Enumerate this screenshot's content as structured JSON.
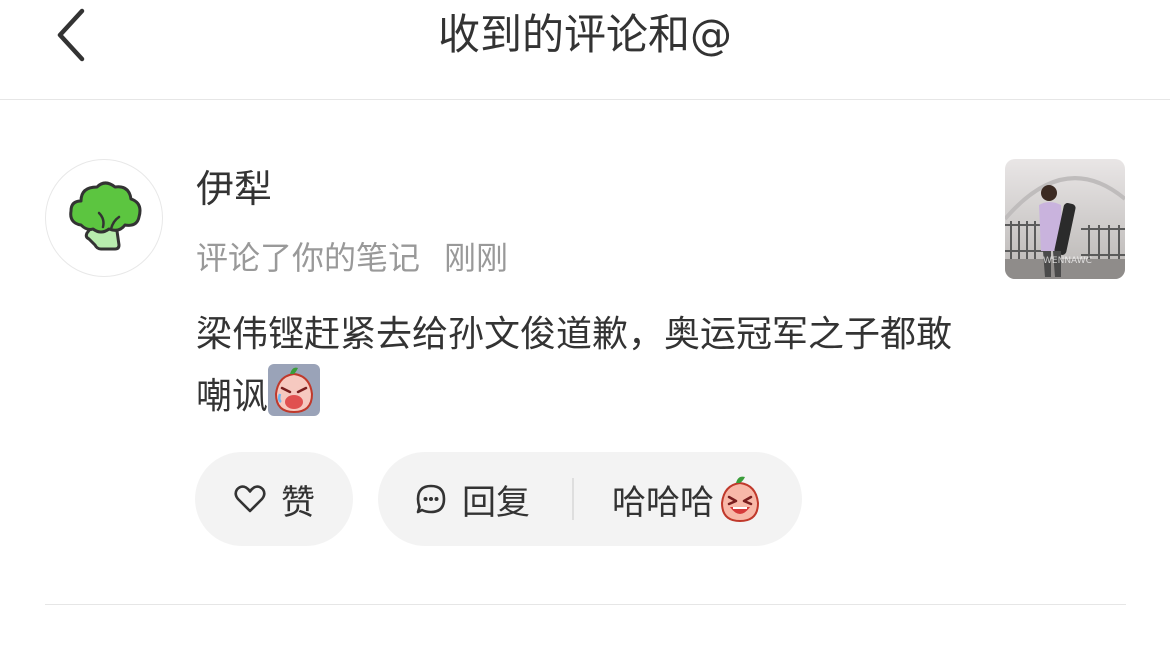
{
  "header": {
    "title": "收到的评论和@"
  },
  "comment": {
    "username": "伊犁",
    "action": "评论了你的笔记",
    "time": "刚刚",
    "text": "梁伟铿赶紧去给孙文俊道歉，奥运冠军之子都敢嘲讽",
    "emoji_name": "crying-radish-emoji",
    "avatar_icon": "broccoli-icon",
    "thumbnail_text": "WENNAWC",
    "accent_color": "#5cc540"
  },
  "actions": {
    "like_label": "赞",
    "reply_label": "回复",
    "quick_reply_label": "哈哈哈",
    "quick_reply_emoji": "laughing-radish-emoji"
  }
}
